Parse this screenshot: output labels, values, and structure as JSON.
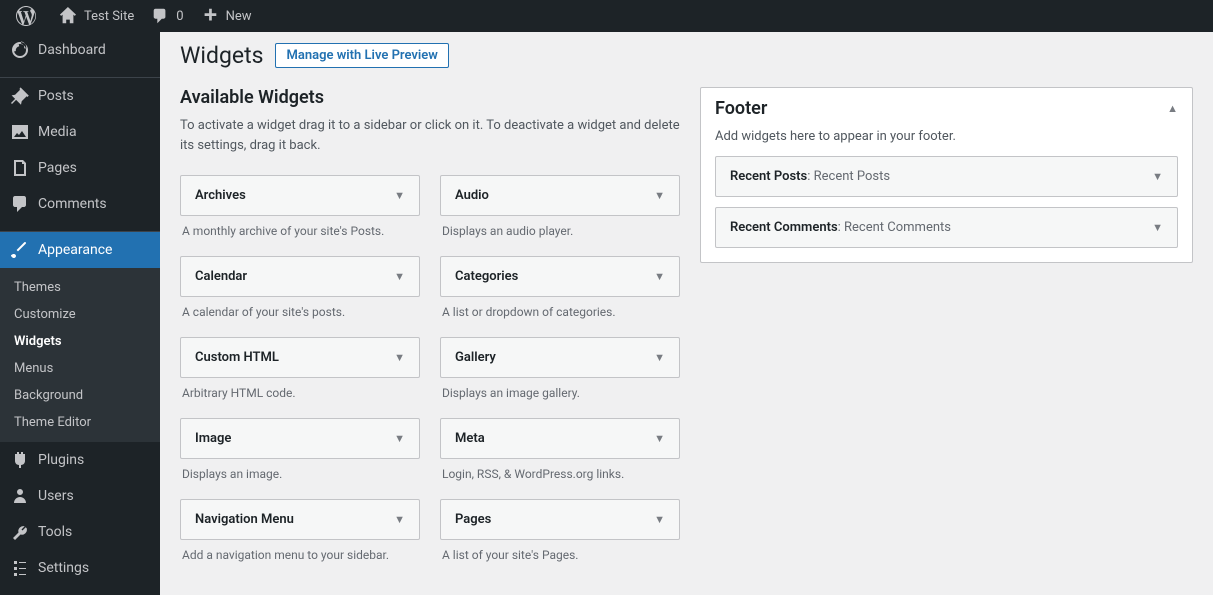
{
  "adminbar": {
    "site": "Test Site",
    "comments": "0",
    "new": "New"
  },
  "sidebar": {
    "dashboard": "Dashboard",
    "posts": "Posts",
    "media": "Media",
    "pages": "Pages",
    "comments": "Comments",
    "appearance": "Appearance",
    "sub": {
      "themes": "Themes",
      "customize": "Customize",
      "widgets": "Widgets",
      "menus": "Menus",
      "background": "Background",
      "editor": "Theme Editor"
    },
    "plugins": "Plugins",
    "users": "Users",
    "tools": "Tools",
    "settings": "Settings"
  },
  "page": {
    "title": "Widgets",
    "action": "Manage with Live Preview",
    "available_title": "Available Widgets",
    "available_desc": "To activate a widget drag it to a sidebar or click on it. To deactivate a widget and delete its settings, drag it back."
  },
  "widgets": {
    "archives": {
      "name": "Archives",
      "desc": "A monthly archive of your site's Posts."
    },
    "audio": {
      "name": "Audio",
      "desc": "Displays an audio player."
    },
    "calendar": {
      "name": "Calendar",
      "desc": "A calendar of your site's posts."
    },
    "categories": {
      "name": "Categories",
      "desc": "A list or dropdown of categories."
    },
    "custom_html": {
      "name": "Custom HTML",
      "desc": "Arbitrary HTML code."
    },
    "gallery": {
      "name": "Gallery",
      "desc": "Displays an image gallery."
    },
    "image": {
      "name": "Image",
      "desc": "Displays an image."
    },
    "meta": {
      "name": "Meta",
      "desc": "Login, RSS, & WordPress.org links."
    },
    "nav_menu": {
      "name": "Navigation Menu",
      "desc": "Add a navigation menu to your sidebar."
    },
    "pages": {
      "name": "Pages",
      "desc": "A list of your site's Pages."
    }
  },
  "area": {
    "title": "Footer",
    "desc": "Add widgets here to appear in your footer.",
    "items": [
      {
        "name": "Recent Posts",
        "label": ": Recent Posts"
      },
      {
        "name": "Recent Comments",
        "label": ": Recent Comments"
      }
    ]
  }
}
